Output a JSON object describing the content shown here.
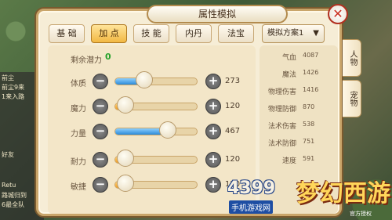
{
  "title": "属性模拟",
  "tabs": [
    {
      "label": "基 础",
      "active": false
    },
    {
      "label": "加 点",
      "active": true
    },
    {
      "label": "技 能",
      "active": false
    },
    {
      "label": "内丹",
      "active": false
    },
    {
      "label": "法宝",
      "active": false
    }
  ],
  "plan": {
    "label": "模拟方案1"
  },
  "potential": {
    "label": "剩余潜力",
    "value": "0"
  },
  "attributes": [
    {
      "label": "体质",
      "value": "273",
      "fill": 0.36,
      "color": "#2b8ad8"
    },
    {
      "label": "魔力",
      "value": "120",
      "fill": 0.13,
      "color": "#f29b1c"
    },
    {
      "label": "力量",
      "value": "467",
      "fill": 0.64,
      "color": "#2b8ad8"
    },
    {
      "label": "耐力",
      "value": "120",
      "fill": 0.13,
      "color": "#f29b1c"
    },
    {
      "label": "敏捷",
      "value": "120",
      "fill": 0.13,
      "color": "#f29b1c"
    }
  ],
  "stats": [
    {
      "label": "气血",
      "value": "4087"
    },
    {
      "label": "魔法",
      "value": "1426"
    },
    {
      "label": "物理伤害",
      "value": "1416"
    },
    {
      "label": "物理防御",
      "value": "870"
    },
    {
      "label": "法术伤害",
      "value": "538"
    },
    {
      "label": "法术防御",
      "value": "751"
    },
    {
      "label": "速度",
      "value": "591"
    }
  ],
  "side_tabs": [
    "人物",
    "宠物"
  ],
  "chat_lines": [
    "前尘",
    "前尘9来",
    "1来入路",
    "好友",
    "Retu",
    "路城归到",
    "6最全队"
  ],
  "watermark": {
    "brand": "4399",
    "sub": "手机游戏网",
    "logo": "梦幻西游",
    "logo_sub": "官方授权"
  },
  "colors": {
    "accent": "#f2b843",
    "panel": "#f6edd6",
    "potential": "#25a12a",
    "close": "#c92d1f"
  }
}
